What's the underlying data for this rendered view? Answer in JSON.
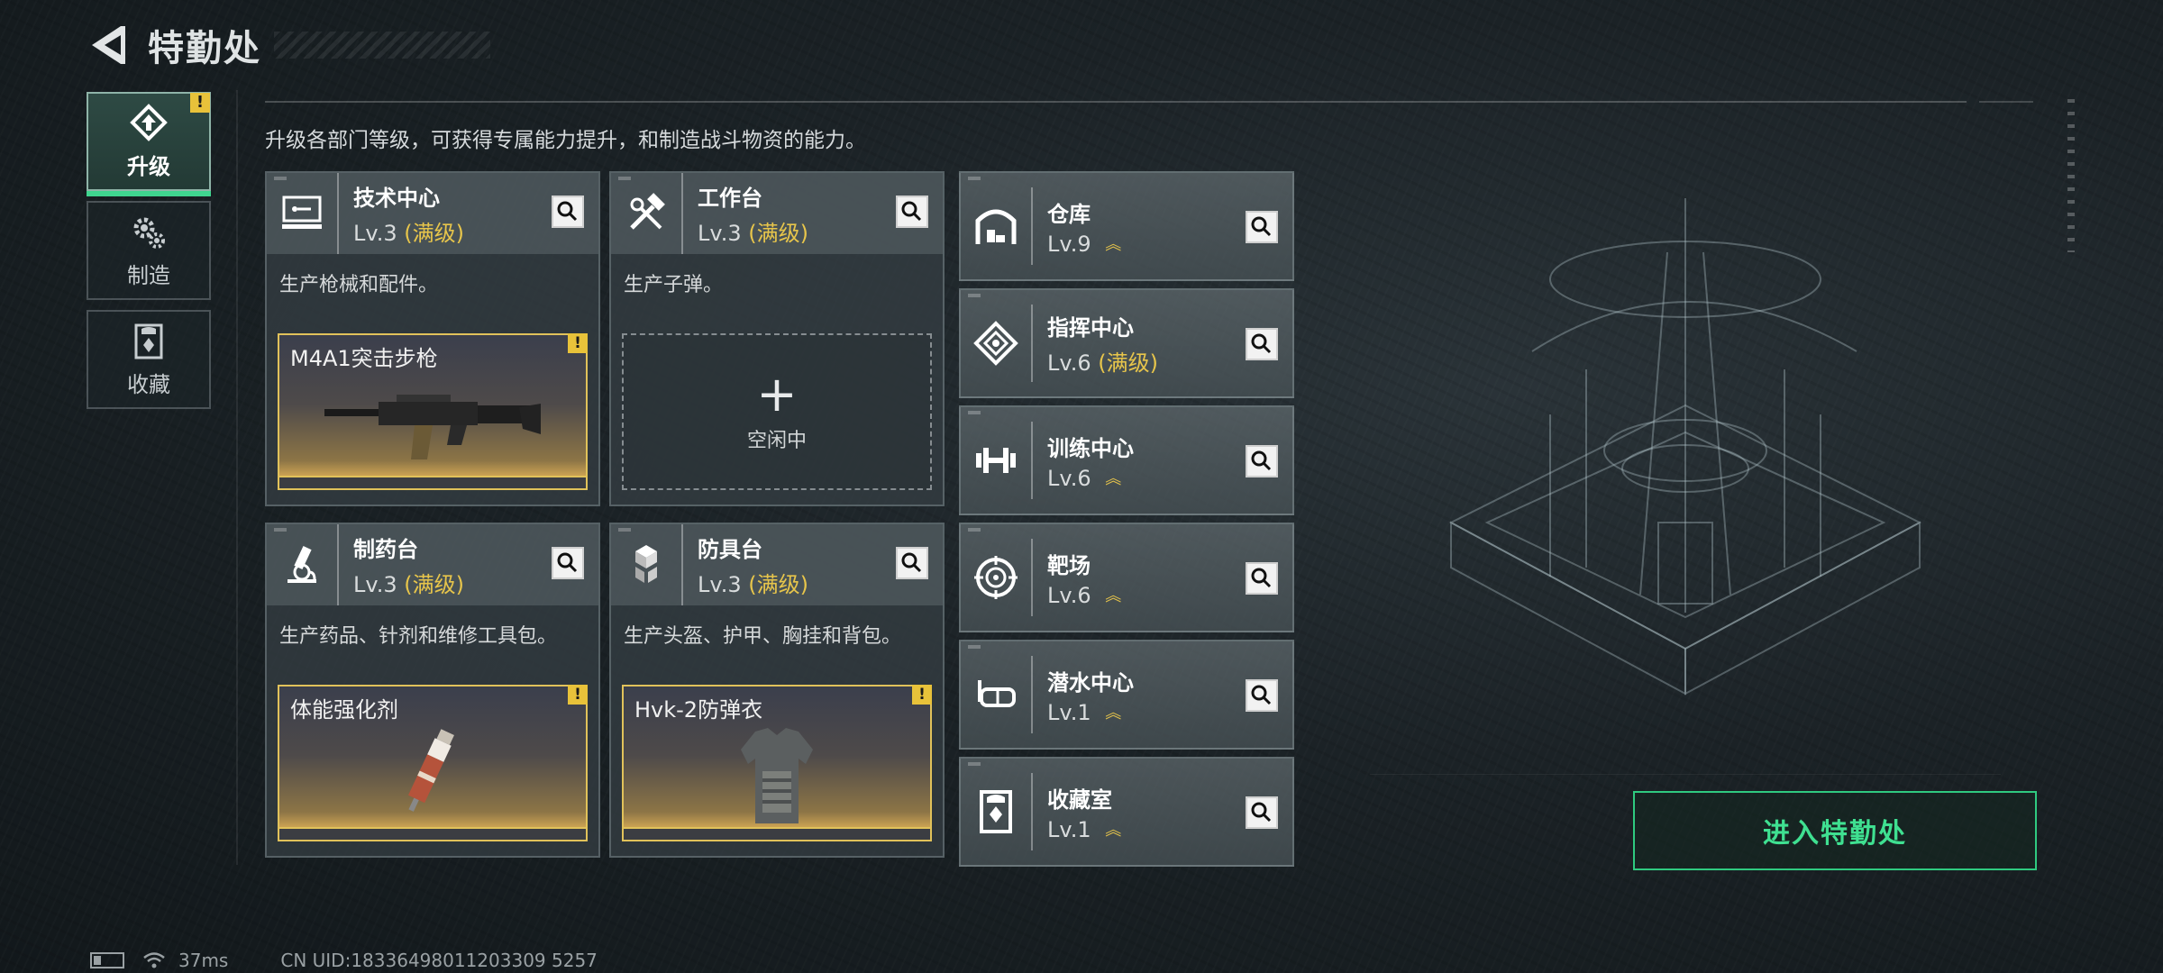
{
  "header": {
    "title": "特勤处"
  },
  "nav": [
    {
      "label": "升级",
      "icon": "upgrade-icon",
      "badge": "!",
      "active": true
    },
    {
      "label": "制造",
      "icon": "gears-icon",
      "active": false
    },
    {
      "label": "收藏",
      "icon": "collection-icon",
      "active": false
    }
  ],
  "description": "升级各部门等级，可获得专属能力提升，和制造战斗物资的能力。",
  "cards": [
    {
      "name": "技术中心",
      "level": "Lv.3",
      "max": "(满级)",
      "desc": "生产枪械和配件。",
      "slot_name": "M4A1突击步枪",
      "slot_badge": "!",
      "icon": "tech-center-icon"
    },
    {
      "name": "工作台",
      "level": "Lv.3",
      "max": "(满级)",
      "desc": "生产子弹。",
      "slot_plus": "+",
      "slot_idle": "空闲中",
      "icon": "workbench-icon"
    },
    {
      "name": "制药台",
      "level": "Lv.3",
      "max": "(满级)",
      "desc": "生产药品、针剂和维修工具包。",
      "slot_name": "体能强化剂",
      "slot_badge": "!",
      "icon": "pharmacy-icon"
    },
    {
      "name": "防具台",
      "level": "Lv.3",
      "max": "(满级)",
      "desc": "生产头盔、护甲、胸挂和背包。",
      "slot_name": "Hvk-2防弹衣",
      "slot_badge": "!",
      "icon": "armor-bench-icon"
    }
  ],
  "small_cards": [
    {
      "name": "仓库",
      "level": "Lv.9",
      "chevron": "︽",
      "icon": "warehouse-icon"
    },
    {
      "name": "指挥中心",
      "level": "Lv.6",
      "max": "(满级)",
      "icon": "command-center-icon"
    },
    {
      "name": "训练中心",
      "level": "Lv.6",
      "chevron": "︽",
      "icon": "training-center-icon"
    },
    {
      "name": "靶场",
      "level": "Lv.6",
      "chevron": "︽",
      "icon": "shooting-range-icon"
    },
    {
      "name": "潜水中心",
      "level": "Lv.1",
      "chevron": "︽",
      "icon": "diving-center-icon"
    },
    {
      "name": "收藏室",
      "level": "Lv.1",
      "chevron": "︽",
      "icon": "collection-room-icon"
    }
  ],
  "enter_button": "进入特勤处",
  "status": {
    "ping": "37ms",
    "uid": "CN UID:18336498011203309 5257"
  },
  "colors": {
    "accent_green": "#3fe091",
    "max_gold": "#e7c54b",
    "badge_yellow": "#e8c23a"
  }
}
